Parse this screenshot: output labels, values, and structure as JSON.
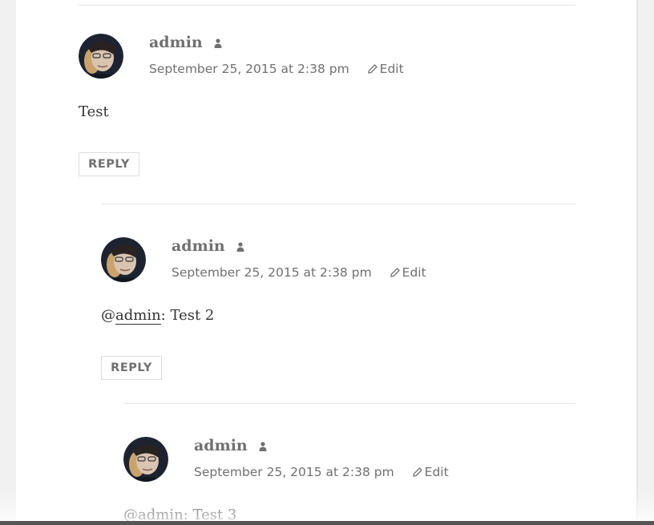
{
  "comments": [
    {
      "author": "admin",
      "date": "September 25, 2015 at 2:38 pm",
      "edit_label": "Edit",
      "mention": "",
      "text_prefix": "",
      "text": "Test",
      "reply_label": "REPLY"
    },
    {
      "author": "admin",
      "date": "September 25, 2015 at 2:38 pm",
      "edit_label": "Edit",
      "mention": "admin",
      "text_prefix": "@",
      "text": ": Test 2",
      "reply_label": "REPLY"
    },
    {
      "author": "admin",
      "date": "September 25, 2015 at 2:38 pm",
      "edit_label": "Edit",
      "mention": "admin",
      "text_prefix": "@",
      "text": ": Test 3"
    }
  ],
  "colors": {
    "meta_text": "#707070",
    "body_text": "#333333",
    "divider": "#e5e5e5",
    "page_background": "#f1f1f1"
  },
  "icons": {
    "author_badge": "person-icon",
    "edit": "pencil-icon"
  }
}
